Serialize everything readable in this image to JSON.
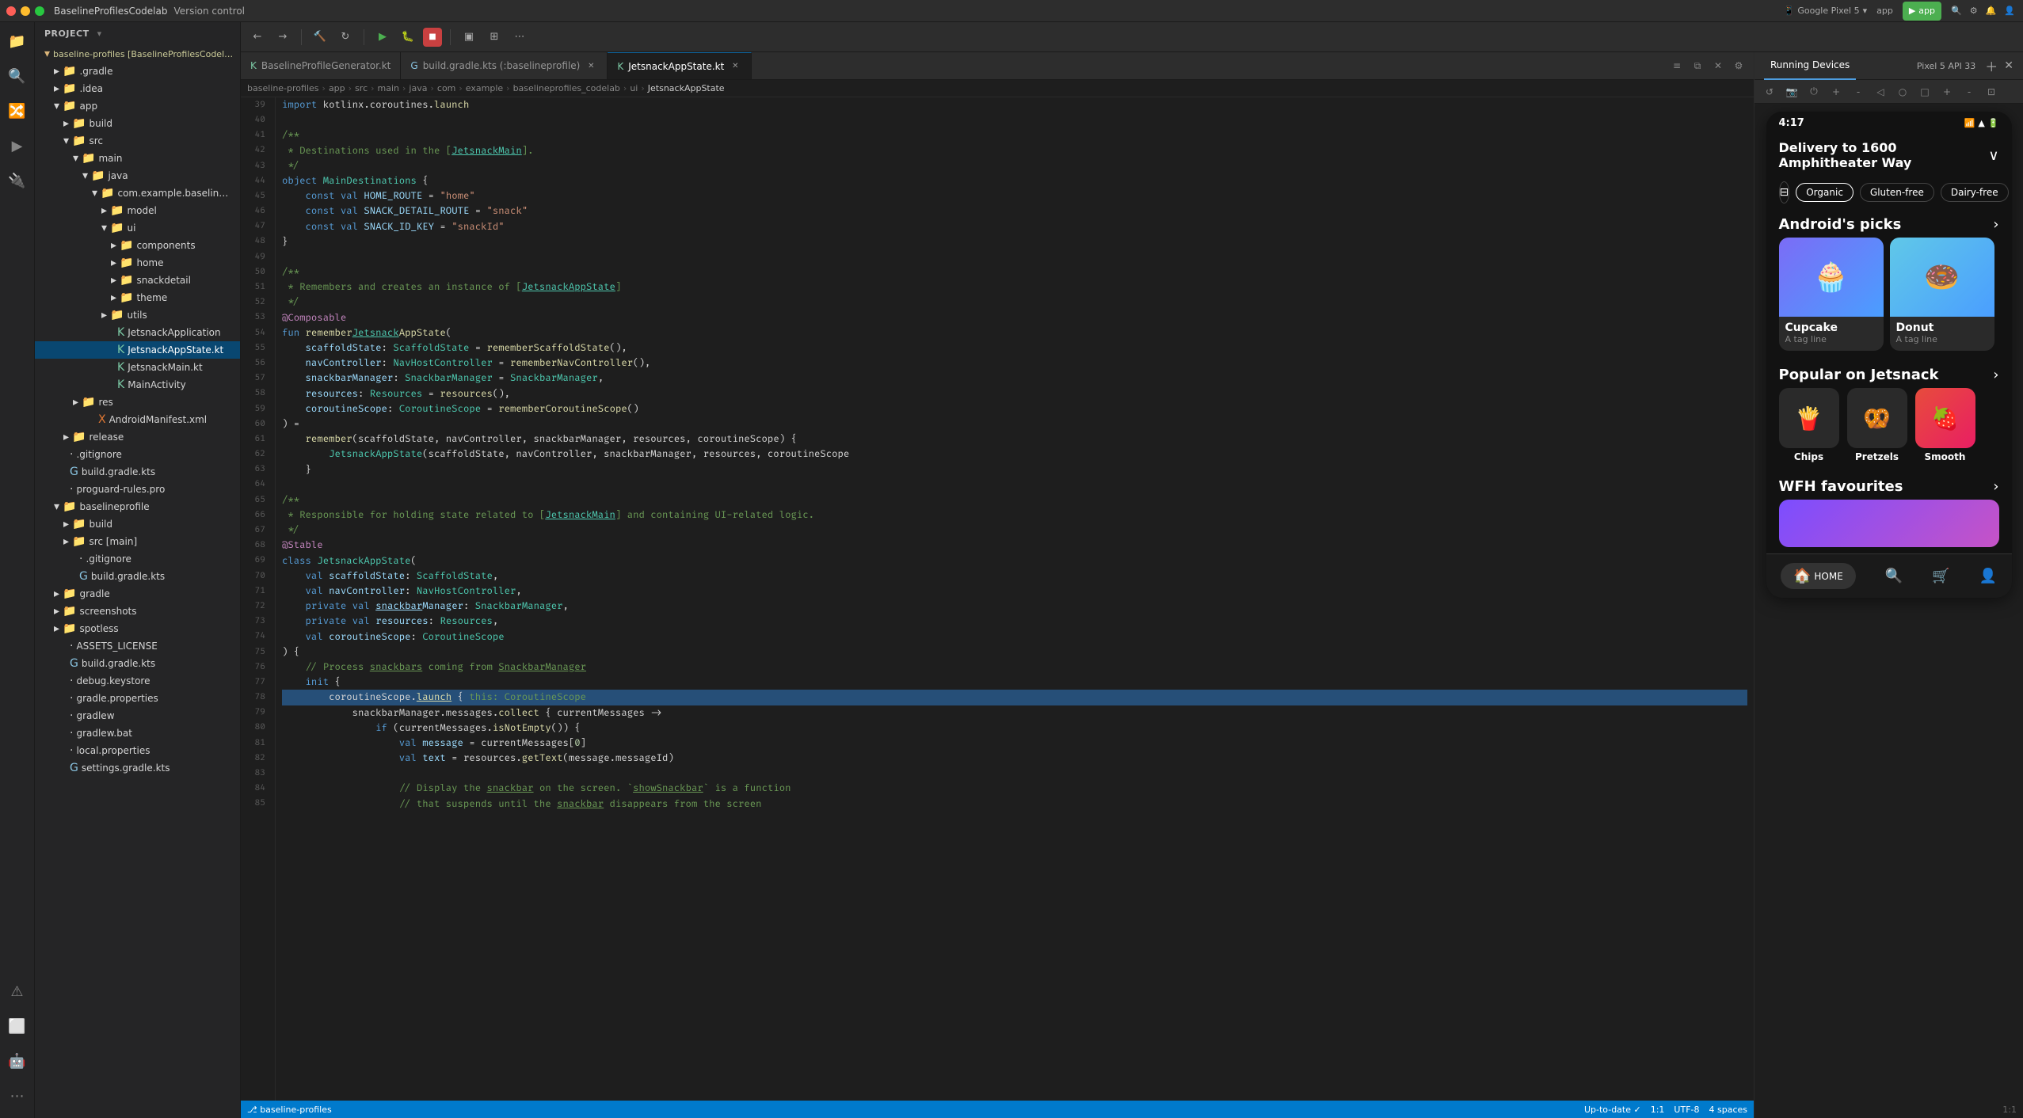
{
  "titlebar": {
    "project_name": "BaselineProfilesCodelab",
    "vcs": "Version control",
    "device": "Google Pixel 5",
    "app_label": "app",
    "run_label": "app"
  },
  "file_explorer": {
    "header": "Project",
    "items": [
      {
        "level": 1,
        "type": "folder",
        "label": "baseline-profiles [BaselineProfilesCodelab]",
        "expanded": true
      },
      {
        "level": 2,
        "type": "folder",
        "label": ".gradle",
        "expanded": false
      },
      {
        "level": 2,
        "type": "folder",
        "label": ".idea",
        "expanded": false
      },
      {
        "level": 2,
        "type": "folder",
        "label": "app",
        "expanded": true
      },
      {
        "level": 3,
        "type": "folder",
        "label": "build",
        "expanded": false
      },
      {
        "level": 3,
        "type": "folder",
        "label": "src",
        "expanded": true
      },
      {
        "level": 4,
        "type": "folder",
        "label": "main",
        "expanded": true
      },
      {
        "level": 5,
        "type": "folder",
        "label": "java",
        "expanded": true
      },
      {
        "level": 6,
        "type": "folder",
        "label": "com.example.baselineprofiles_codel",
        "expanded": true
      },
      {
        "level": 7,
        "type": "folder",
        "label": "model",
        "expanded": false
      },
      {
        "level": 7,
        "type": "folder",
        "label": "ui",
        "expanded": true
      },
      {
        "level": 8,
        "type": "folder",
        "label": "components",
        "expanded": false
      },
      {
        "level": 8,
        "type": "folder",
        "label": "home",
        "expanded": false
      },
      {
        "level": 8,
        "type": "folder",
        "label": "snackdetail",
        "expanded": false
      },
      {
        "level": 8,
        "type": "folder",
        "label": "theme",
        "expanded": false
      },
      {
        "level": 7,
        "type": "folder",
        "label": "utils",
        "expanded": false
      },
      {
        "level": 7,
        "type": "file",
        "label": "JetsnackApplication",
        "fileType": "kt"
      },
      {
        "level": 7,
        "type": "file",
        "label": "JetsnackAppState.kt",
        "fileType": "kt",
        "active": true
      },
      {
        "level": 7,
        "type": "file",
        "label": "JetsnackMain.kt",
        "fileType": "kt"
      },
      {
        "level": 7,
        "type": "file",
        "label": "MainActivity",
        "fileType": "kt"
      },
      {
        "level": 4,
        "type": "folder",
        "label": "res",
        "expanded": false
      },
      {
        "level": 5,
        "type": "file",
        "label": "AndroidManifest.xml",
        "fileType": "xml"
      },
      {
        "level": 3,
        "type": "folder",
        "label": "release",
        "expanded": false
      },
      {
        "level": 2,
        "type": "file",
        "label": ".gitignore",
        "fileType": "generic"
      },
      {
        "level": 2,
        "type": "file",
        "label": "build.gradle.kts",
        "fileType": "gradle"
      },
      {
        "level": 2,
        "type": "file",
        "label": "proguard-rules.pro",
        "fileType": "generic"
      },
      {
        "level": 2,
        "type": "folder",
        "label": "baselineprofile",
        "expanded": true
      },
      {
        "level": 3,
        "type": "folder",
        "label": "build",
        "expanded": false
      },
      {
        "level": 3,
        "type": "folder",
        "label": "src [main]",
        "expanded": false
      },
      {
        "level": 3,
        "type": "file",
        "label": ".gitignore",
        "fileType": "generic"
      },
      {
        "level": 3,
        "type": "file",
        "label": "build.gradle.kts",
        "fileType": "gradle"
      },
      {
        "level": 2,
        "type": "folder",
        "label": "gradle",
        "expanded": false
      },
      {
        "level": 2,
        "type": "folder",
        "label": "screenshots",
        "expanded": false
      },
      {
        "level": 2,
        "type": "folder",
        "label": "spotless",
        "expanded": false
      },
      {
        "level": 2,
        "type": "file",
        "label": "ASSETS_LICENSE",
        "fileType": "generic"
      },
      {
        "level": 2,
        "type": "file",
        "label": "build.gradle.kts",
        "fileType": "gradle"
      },
      {
        "level": 2,
        "type": "file",
        "label": "debug.keystore",
        "fileType": "generic"
      },
      {
        "level": 2,
        "type": "file",
        "label": "gradle.properties",
        "fileType": "generic"
      },
      {
        "level": 2,
        "type": "file",
        "label": "gradlew",
        "fileType": "generic"
      },
      {
        "level": 2,
        "type": "file",
        "label": "gradlew.bat",
        "fileType": "generic"
      },
      {
        "level": 2,
        "type": "file",
        "label": "local.properties",
        "fileType": "generic"
      },
      {
        "level": 2,
        "type": "file",
        "label": "settings.gradle.kts",
        "fileType": "gradle"
      }
    ]
  },
  "tabs": [
    {
      "label": "BaselineProfileGenerator.kt",
      "active": false,
      "pinned": false
    },
    {
      "label": "build.gradle.kts (:baselineprofile)",
      "active": false,
      "pinned": false
    },
    {
      "label": "JetsnackAppState.kt",
      "active": true,
      "pinned": false
    }
  ],
  "code": {
    "filename": "JetsnackAppState.kt",
    "lines": [
      {
        "n": 39,
        "content": "import kotlinx.coroutines.launch"
      },
      {
        "n": 40,
        "content": ""
      },
      {
        "n": 41,
        "content": "/**"
      },
      {
        "n": 42,
        "content": " * Destinations used in the [JetsnackMain]."
      },
      {
        "n": 43,
        "content": " */"
      },
      {
        "n": 44,
        "content": "object MainDestinations {"
      },
      {
        "n": 45,
        "content": "    const val HOME_ROUTE = \"home\""
      },
      {
        "n": 46,
        "content": "    const val SNACK_DETAIL_ROUTE = \"snack\""
      },
      {
        "n": 47,
        "content": "    const val SNACK_ID_KEY = \"snackId\""
      },
      {
        "n": 48,
        "content": "}"
      },
      {
        "n": 49,
        "content": ""
      },
      {
        "n": 50,
        "content": "/**"
      },
      {
        "n": 51,
        "content": " * Remembers and creates an instance of [JetsnackAppState]"
      },
      {
        "n": 52,
        "content": " */"
      },
      {
        "n": 53,
        "content": "@Composable"
      },
      {
        "n": 54,
        "content": "fun rememberJetsnackAppState("
      },
      {
        "n": 55,
        "content": "    scaffoldState: ScaffoldState = rememberScaffoldState(),"
      },
      {
        "n": 56,
        "content": "    navController: NavHostController = rememberNavController(),"
      },
      {
        "n": 57,
        "content": "    snackbarManager: SnackbarManager = SnackbarManager,"
      },
      {
        "n": 58,
        "content": "    resources: Resources = resources(),"
      },
      {
        "n": 59,
        "content": "    coroutineScope: CoroutineScope = rememberCoroutineScope()"
      },
      {
        "n": 60,
        "content": ") ="
      },
      {
        "n": 61,
        "content": "    remember(scaffoldState, navController, snackbarManager, resources, coroutineScope) {"
      },
      {
        "n": 62,
        "content": "        JetsnackAppState(scaffoldState, navController, snackbarManager, resources, coroutineScope"
      },
      {
        "n": 63,
        "content": "    }"
      },
      {
        "n": 64,
        "content": ""
      },
      {
        "n": 65,
        "content": "/**"
      },
      {
        "n": 66,
        "content": " * Responsible for holding state related to [JetsnackMain] and containing UI-related logic."
      },
      {
        "n": 67,
        "content": " */"
      },
      {
        "n": 68,
        "content": "@Stable"
      },
      {
        "n": 69,
        "content": "class JetsnackAppState("
      },
      {
        "n": 70,
        "content": "    val scaffoldState: ScaffoldState,"
      },
      {
        "n": 71,
        "content": "    val navController: NavHostController,"
      },
      {
        "n": 72,
        "content": "    private val snackbarManager: SnackbarManager,"
      },
      {
        "n": 73,
        "content": "    private val resources: Resources,"
      },
      {
        "n": 74,
        "content": "    val coroutineScope: CoroutineScope"
      },
      {
        "n": 75,
        "content": ") {"
      },
      {
        "n": 76,
        "content": "    // Process snackbars coming from SnackbarManager"
      },
      {
        "n": 77,
        "content": "    init {"
      },
      {
        "n": 78,
        "content": "        coroutineScope.launch { this: CoroutineScope"
      },
      {
        "n": 79,
        "content": "            snackbarManager.messages.collect { currentMessages ->"
      },
      {
        "n": 80,
        "content": "                if (currentMessages.isNotEmpty()) {"
      },
      {
        "n": 81,
        "content": "                    val message = currentMessages[0]"
      },
      {
        "n": 82,
        "content": "                    val text = resources.getText(message.messageId)"
      },
      {
        "n": 83,
        "content": ""
      },
      {
        "n": 84,
        "content": "                    // Display the snackbar on the screen. `showSnackbar` is a function"
      },
      {
        "n": 85,
        "content": "                    // that suspends until the snackbar disappears from the screen"
      }
    ]
  },
  "breadcrumb": {
    "items": [
      "baseline-profiles",
      "app",
      "src",
      "main",
      "java",
      "com",
      "example",
      "baselineprofiles_codelab",
      "ui",
      "JetsnackAppState"
    ]
  },
  "running_devices": {
    "header": "Running Devices",
    "device_name": "Pixel 5 API 33",
    "phone": {
      "time": "4:17",
      "delivery_address": "Delivery to 1600 Amphitheater Way",
      "filter_chips": [
        "Organic",
        "Gluten-free",
        "Dairy-free"
      ],
      "sections": [
        {
          "title": "Android's picks",
          "items": [
            {
              "name": "Cupcake",
              "subtitle": "A tag line",
              "type": "cupcake"
            },
            {
              "name": "Donut",
              "subtitle": "A tag line",
              "type": "donut"
            }
          ]
        },
        {
          "title": "Popular on Jetsnack",
          "items": [
            {
              "name": "Chips"
            },
            {
              "name": "Pretzels"
            },
            {
              "name": "Smooth"
            }
          ]
        },
        {
          "title": "WFH favourites"
        }
      ],
      "nav": [
        {
          "label": "HOME",
          "active": true,
          "icon": "🏠"
        },
        {
          "label": "",
          "active": false,
          "icon": "🔍"
        },
        {
          "label": "",
          "active": false,
          "icon": "🛒"
        },
        {
          "label": "",
          "active": false,
          "icon": "👤"
        }
      ]
    }
  },
  "status_bar": {
    "branch": "baseline-profiles",
    "path": "app > src > main > java > com > example > baselineprofiles_codelab > ui > JetsnackAppState",
    "position": "1:1",
    "encoding": "UTF-8",
    "indent": "4 spaces"
  }
}
